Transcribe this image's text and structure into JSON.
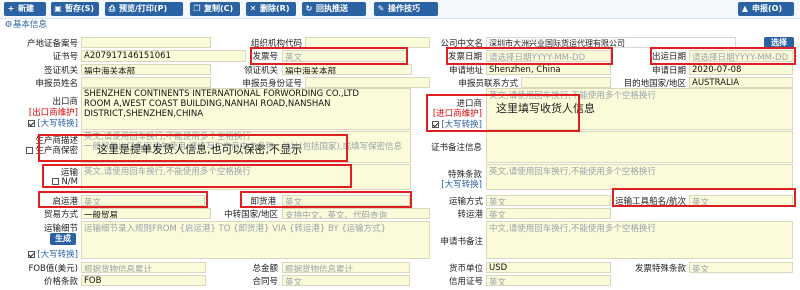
{
  "toolbar": {
    "buttons": [
      "新建",
      "暂存(S)",
      "预览/打印(P)",
      "复制(C)",
      "删除(R)",
      "回执推送",
      "操作技巧"
    ],
    "submit": "申报(O)"
  },
  "section_title": "基本信息",
  "form": {
    "prod_cert_label": "产地证备案号",
    "org_code_label": "组织机构代码",
    "company_label": "公司中文名",
    "company_value": "深圳市大洲兴业国际货运代理有限公司",
    "select_btn": "选择",
    "cert_no_label": "证书号",
    "cert_no_value": "A207917146151061",
    "invoice_no_label": "发票号",
    "invoice_no_value": "英文",
    "invoice_date_label": "发票日期",
    "invoice_date_placeholder": "请选择日期YYYY-MM-DD",
    "export_date_label": "出运日期",
    "export_date_placeholder": "请选择日期YYYY-MM-DD",
    "visa_org_label": "签证机关",
    "visa_org_value": "福中海关本部",
    "pickup_org_label": "领证机关",
    "pickup_org_value": "福中海关本部",
    "apply_place_label": "申请地址",
    "apply_place_value": "Shenzhen, China",
    "apply_date_label": "申请日期",
    "apply_date_value": "2020-07-08",
    "declarant_label": "申报员姓名",
    "declarant_id_label": "申报员身份证号",
    "declarant_phone_label": "申报员联系方式",
    "dest_label": "目的地国家/地区",
    "dest_value": "AUSTRALIA",
    "exporter_label": "出口商",
    "exporter_sub": "[出口商维护]",
    "exporter_tag": "[大写转换]",
    "exporter_value": "SHENZHEN CONTINENTS INTERNATIONAL FORWORDING CO.,LTD\nROOM A,WEST COAST BUILDING,NANHAI ROAD,NANSHAN\nDISTRICT,SHENZHEN,CHINA",
    "importer_label": "进口商",
    "importer_sub": "[进口商维护]",
    "importer_tag": "[大写转换]",
    "importer_placeholder": "英文,请使用回车换行,不能使用多个空格换行",
    "importer_note": "这里填写收货人信息",
    "producer_label": "生产商描述",
    "producer_sub": "生产商保密",
    "producer_placeholder": "英文,请使用回车换行,不能使用多个空格换行\n一般贸易出口备案请勿使用,请填写生产商中文名称、地址(包括国家),或填写保密信息",
    "producer_note": "这里是提单发货人信息,也可以保密,不显示",
    "cert_remark_label": "证书备注信息",
    "transport_label": "运输",
    "nm_label": "N/M",
    "special_label": "特殊条款",
    "special_tag": "[大写转换]",
    "special_placeholder": "英文,请使用回车换行,不能使用多个空格换行",
    "nm_placeholder": "英文,请使用回车换行,不能使用多个空格换行",
    "loading_port_label": "启运港",
    "loading_port_value": "英文",
    "discharge_port_label": "卸货港",
    "discharge_port_value": "英文",
    "transport_mode_label": "运输方式",
    "transport_mode_value": "英文",
    "vessel_label": "运输工具船名/航次",
    "vessel_value": "英文",
    "trade_mode_label": "贸易方式",
    "trade_mode_value": "一般贸易",
    "transit_country_label": "中转国家/地区",
    "transit_country_placeholder": "支持中文、英文、代码查询",
    "transit_port_label": "转运港",
    "transit_port_value": "英文",
    "route_label": "运输细节",
    "route_btn": "生成",
    "route_tag": "[大写转换]",
    "route_placeholder": "运输细节录入规则FROM {启运港} TO {卸货港} VIA {转运港} BY {运输方式}",
    "applicant_remark_label": "申请书备注",
    "applicant_remark_placeholder": "中文,请使用回车换行,不能使用多个空格换行",
    "fob_label": "FOB值(美元)",
    "fob_placeholder": "根据货物信息累计",
    "total_label": "总金额",
    "total_placeholder": "根据货物信息累计",
    "currency_label": "货币单位",
    "currency_value": "USD",
    "invoice_special_label": "发票特殊条款",
    "invoice_special_value": "英文",
    "price_terms_label": "价格条款",
    "price_terms_value": "FOB",
    "contract_label": "合同号",
    "contract_value": "英文",
    "credit_label": "信用证号",
    "credit_value": "英文"
  }
}
